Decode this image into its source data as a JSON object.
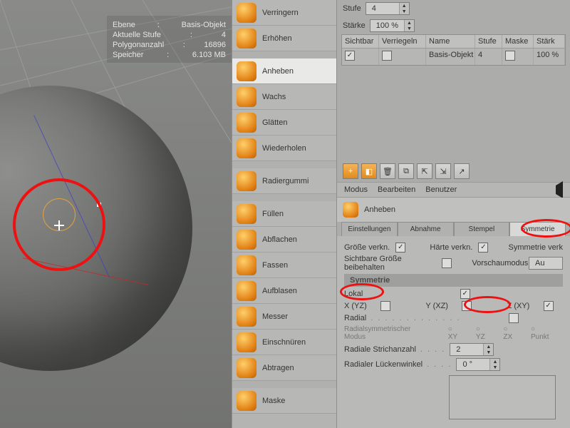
{
  "hud": {
    "rows": [
      {
        "k": "Ebene",
        "v": "Basis-Objekt"
      },
      {
        "k": "Aktuelle Stufe",
        "v": "4"
      },
      {
        "k": "Polygonanzahl",
        "v": "16896"
      },
      {
        "k": "Speicher",
        "v": "6.103 MB"
      }
    ]
  },
  "tools": [
    {
      "id": "verringern",
      "label": "Verringern",
      "icon": "shrink-icon"
    },
    {
      "id": "erhoehen",
      "label": "Erhöhen",
      "icon": "grow-icon"
    },
    {
      "sep": true
    },
    {
      "id": "anheben",
      "label": "Anheben",
      "icon": "pull-icon",
      "active": true
    },
    {
      "id": "wachs",
      "label": "Wachs",
      "icon": "wax-icon"
    },
    {
      "id": "glaetten",
      "label": "Glätten",
      "icon": "smooth-icon"
    },
    {
      "id": "wiederholen",
      "label": "Wiederholen",
      "icon": "repeat-icon"
    },
    {
      "sep": true
    },
    {
      "id": "radiergummi",
      "label": "Radiergummi",
      "icon": "eraser-icon"
    },
    {
      "sep": true
    },
    {
      "id": "fuellen",
      "label": "Füllen",
      "icon": "fill-icon"
    },
    {
      "id": "abflachen",
      "label": "Abflachen",
      "icon": "flatten-icon"
    },
    {
      "id": "fassen",
      "label": "Fassen",
      "icon": "grab-icon"
    },
    {
      "id": "aufblasen",
      "label": "Aufblasen",
      "icon": "inflate-icon"
    },
    {
      "id": "messer",
      "label": "Messer",
      "icon": "knife-icon"
    },
    {
      "id": "einschnueren",
      "label": "Einschnüren",
      "icon": "pinch-icon"
    },
    {
      "id": "abtragen",
      "label": "Abtragen",
      "icon": "scrape-icon"
    },
    {
      "sep": true
    },
    {
      "id": "maske",
      "label": "Maske",
      "icon": "mask-icon"
    }
  ],
  "top": {
    "stufe_label": "Stufe",
    "stufe_value": "4",
    "staerke_label": "Stärke",
    "staerke_value": "100 %"
  },
  "table": {
    "headers": {
      "sichtbar": "Sichtbar",
      "verriegeln": "Verriegeln",
      "name": "Name",
      "stufe": "Stufe",
      "maske": "Maske",
      "staerke": "Stärk"
    },
    "rows": [
      {
        "sichtbar": true,
        "verriegeln": false,
        "name": "Basis-Objekt",
        "stufe": "4",
        "maske": false,
        "staerke": "100 %"
      }
    ]
  },
  "menu": {
    "modus": "Modus",
    "bearbeiten": "Bearbeiten",
    "benutzer": "Benutzer"
  },
  "section": {
    "title": "Anheben"
  },
  "tabs": {
    "einstellungen": "Einstellungen",
    "abnahme": "Abnahme",
    "stempel": "Stempel",
    "symmetrie": "Symmetrie"
  },
  "settings": {
    "groesse": "Größe verkn.",
    "haerte": "Härte verkn.",
    "symm_verkn": "Symmetrie verk",
    "sicht_groesse": "Sichtbare Größe beibehalten",
    "vorschau": "Vorschaumodus",
    "vorschau_val": "Au"
  },
  "symmetry": {
    "header": "Symmetrie",
    "lokal": "Lokal",
    "x": "X (YZ)",
    "y": "Y (XZ)",
    "z": "Z (XY)",
    "radial": "Radial",
    "radial_mode": "Radialsymmetrischer Modus",
    "radial_strokes": "Radiale Strichanzahl",
    "radial_strokes_val": "2",
    "radial_gap": "Radialer Lückenwinkel",
    "radial_gap_val": "0 °",
    "axis_opts": {
      "xy": "XY",
      "yz": "YZ",
      "zx": "ZX",
      "punkt": "Punkt"
    }
  }
}
